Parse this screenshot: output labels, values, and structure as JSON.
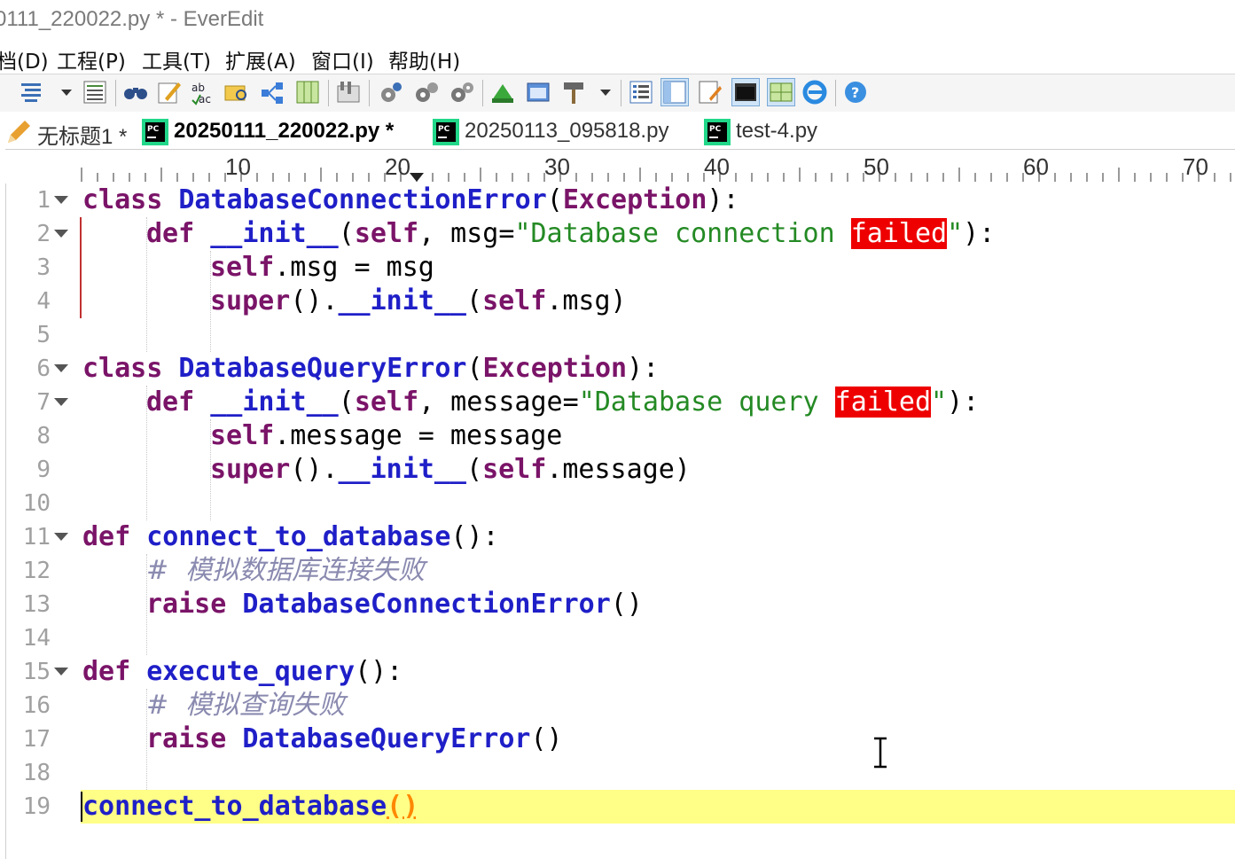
{
  "window": {
    "title": "0111_220022.py * - EverEdit"
  },
  "menu": {
    "items": [
      {
        "label": "档(D)"
      },
      {
        "label": "工程(P)"
      },
      {
        "label": "工具(T)"
      },
      {
        "label": "扩展(A)"
      },
      {
        "label": "窗口(I)"
      },
      {
        "label": "帮助(H)"
      }
    ]
  },
  "toolbar": {
    "icons": [
      "format-icon",
      "dropdown-icon",
      "list-icon",
      "find-icon",
      "edit-icon",
      "spellcheck-icon",
      "folder-search-icon",
      "share-icon",
      "columns-icon",
      "ruler-icon",
      "settings-icon",
      "gears-icon",
      "gears2-icon",
      "green-arrow-icon",
      "window-icon",
      "build-icon",
      "dropdown-icon",
      "outline-icon",
      "panel-icon",
      "notes-icon",
      "console-icon",
      "grid-icon",
      "ie-icon",
      "help-icon"
    ]
  },
  "tabs": [
    {
      "label": "无标题1 *",
      "icon": "pencil-icon",
      "active": false
    },
    {
      "label": "20250111_220022.py *",
      "icon": "pycharm-icon",
      "active": true
    },
    {
      "label": "20250113_095818.py",
      "icon": "pycharm-icon",
      "active": false
    },
    {
      "label": "test-4.py",
      "icon": "pycharm-icon",
      "active": false
    }
  ],
  "ruler": {
    "labels": [
      "10",
      "20",
      "30",
      "40",
      "50",
      "60",
      "70"
    ]
  },
  "editor": {
    "current_line": 19,
    "lines": [
      {
        "n": "1"
      },
      {
        "n": "2"
      },
      {
        "n": "3"
      },
      {
        "n": "4"
      },
      {
        "n": "5"
      },
      {
        "n": "6"
      },
      {
        "n": "7"
      },
      {
        "n": "8"
      },
      {
        "n": "9"
      },
      {
        "n": "10"
      },
      {
        "n": "11"
      },
      {
        "n": "12"
      },
      {
        "n": "13"
      },
      {
        "n": "14"
      },
      {
        "n": "15"
      },
      {
        "n": "16"
      },
      {
        "n": "17"
      },
      {
        "n": "18"
      },
      {
        "n": "19"
      }
    ],
    "tokens": {
      "l1": [
        "class",
        " ",
        "DatabaseConnectionError",
        "(",
        "Exception",
        "):"
      ],
      "l2": [
        "def",
        " ",
        "__init__",
        "(",
        "self",
        ", msg=",
        "\"Database connection ",
        "failed",
        "\"",
        "):"
      ],
      "l3": [
        "self",
        ".msg = msg"
      ],
      "l4": [
        "super",
        "().",
        "__init__",
        "(",
        "self",
        ".msg)"
      ],
      "l6": [
        "class",
        " ",
        "DatabaseQueryError",
        "(",
        "Exception",
        "):"
      ],
      "l7": [
        "def",
        " ",
        "__init__",
        "(",
        "self",
        ", message=",
        "\"Database query ",
        "failed",
        "\"",
        "):"
      ],
      "l8": [
        "self",
        ".message = message"
      ],
      "l9": [
        "super",
        "().",
        "__init__",
        "(",
        "self",
        ".message)"
      ],
      "l11": [
        "def",
        " ",
        "connect_to_database",
        "():"
      ],
      "l12": [
        "#  模拟数据库连接失败"
      ],
      "l13": [
        "raise",
        " ",
        "DatabaseConnectionError",
        "()"
      ],
      "l15": [
        "def",
        " ",
        "execute_query",
        "():"
      ],
      "l16": [
        "#  模拟查询失败"
      ],
      "l17": [
        "raise",
        " ",
        "DatabaseQueryError",
        "()"
      ],
      "l19": [
        "connect_to_database",
        "()"
      ]
    }
  },
  "colors": {
    "keyword": "#7a1468",
    "identifier": "#1f1fc8",
    "string": "#248a24",
    "highlight": "#ee0000",
    "comment": "#8a8ab0",
    "current_line": "#ffff88",
    "bracket": "#ff8800"
  }
}
